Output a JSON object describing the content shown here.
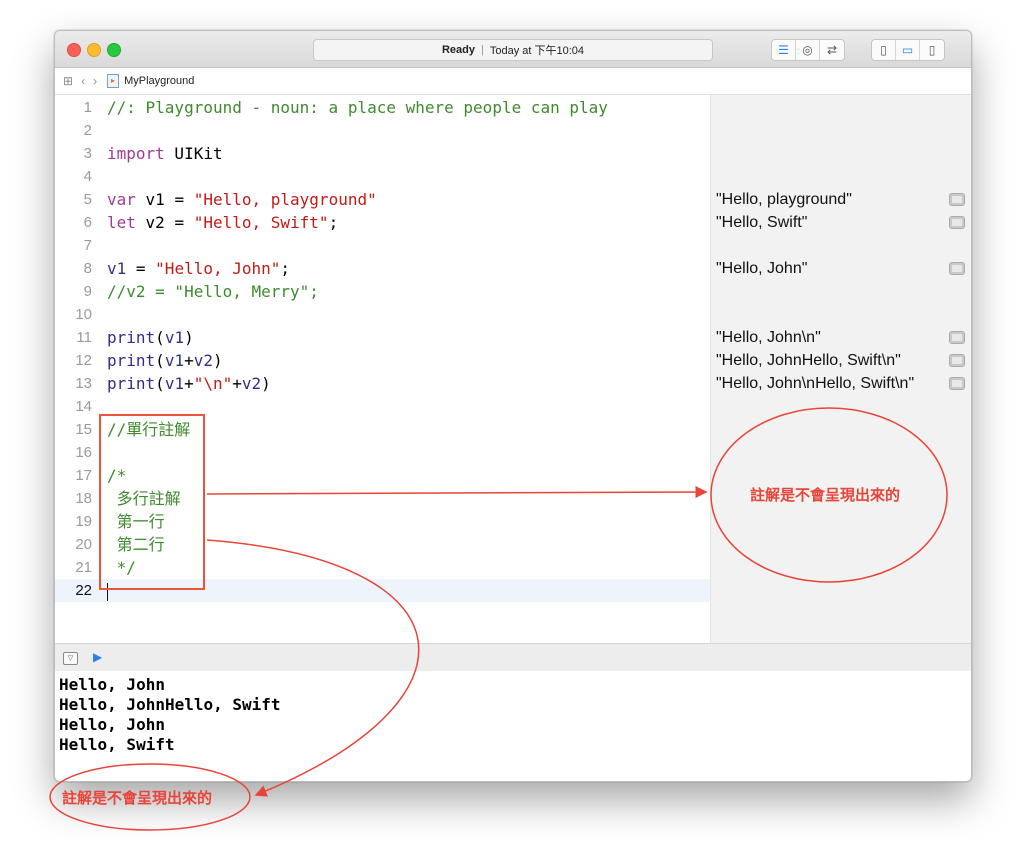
{
  "window": {
    "status_label": "Ready",
    "status_time": "Today at 下午10:04"
  },
  "navbar": {
    "file_name": "MyPlayground"
  },
  "editor": {
    "lines": [
      {
        "num": "1",
        "html": "<span class='cmt'>//: Playground - noun: a place where people can play</span>"
      },
      {
        "num": "2",
        "html": ""
      },
      {
        "num": "3",
        "html": "<span class='kw'>import</span> UIKit"
      },
      {
        "num": "4",
        "html": ""
      },
      {
        "num": "5",
        "html": "<span class='kw'>var</span> v1 = <span class='str'>\"Hello, playground\"</span>"
      },
      {
        "num": "6",
        "html": "<span class='kw'>let</span> v2 = <span class='str'>\"Hello, Swift\"</span>;"
      },
      {
        "num": "7",
        "html": ""
      },
      {
        "num": "8",
        "html": "<span class='id'>v1</span> = <span class='str'>\"Hello, John\"</span>;"
      },
      {
        "num": "9",
        "html": "<span class='cmt'>//v2 = \"Hello, Merry\";</span>"
      },
      {
        "num": "10",
        "html": ""
      },
      {
        "num": "11",
        "html": "<span class='fn'>print</span>(<span class='id'>v1</span>)"
      },
      {
        "num": "12",
        "html": "<span class='fn'>print</span>(<span class='id'>v1</span>+<span class='id'>v2</span>)"
      },
      {
        "num": "13",
        "html": "<span class='fn'>print</span>(<span class='id'>v1</span>+<span class='str'>\"\\n\"</span>+<span class='id'>v2</span>)"
      },
      {
        "num": "14",
        "html": ""
      },
      {
        "num": "15",
        "html": "<span class='cmt'>//單行註解</span>"
      },
      {
        "num": "16",
        "html": ""
      },
      {
        "num": "17",
        "html": "<span class='cmt'>/*</span>"
      },
      {
        "num": "18",
        "html": "<span class='cmt'> 多行註解</span>"
      },
      {
        "num": "19",
        "html": "<span class='cmt'> 第一行</span>"
      },
      {
        "num": "20",
        "html": "<span class='cmt'> 第二行</span>"
      },
      {
        "num": "21",
        "html": "<span class='cmt'> */</span>"
      },
      {
        "num": "22",
        "html": "<span class='caret'></span>"
      }
    ],
    "current_line": "22"
  },
  "results": [
    {
      "line": "5",
      "text": "\"Hello, playground\""
    },
    {
      "line": "6",
      "text": "\"Hello, Swift\""
    },
    {
      "line": "8",
      "text": "\"Hello, John\""
    },
    {
      "line": "11",
      "text": "\"Hello, John\\n\""
    },
    {
      "line": "12",
      "text": "\"Hello, JohnHello, Swift\\n\""
    },
    {
      "line": "13",
      "text": "\"Hello, John\\nHello, Swift\\n\""
    }
  ],
  "console": {
    "lines": [
      "Hello, John",
      "Hello, JohnHello, Swift",
      "Hello, John",
      "Hello, Swift"
    ]
  },
  "annotations": {
    "note_right": "註解是不會呈現出來的",
    "note_bottom": "註解是不會呈現出來的",
    "color": "#e8453a"
  }
}
